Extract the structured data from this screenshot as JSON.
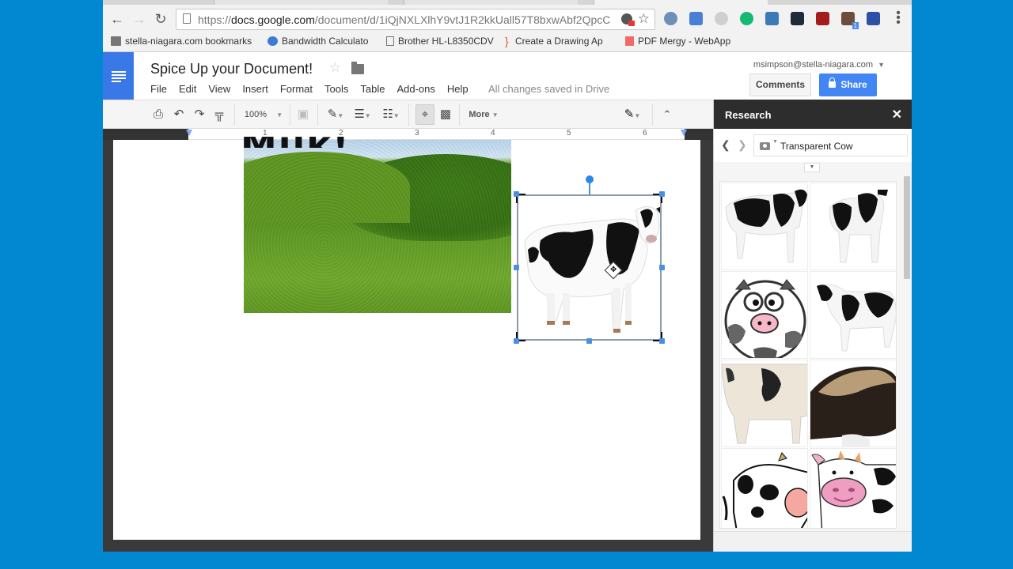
{
  "browser": {
    "url_prefix": "https://",
    "url_domain": "docs.google.com",
    "url_path": "/document/d/1iQjNXLXlhY9vtJ1R2kkUall57T8bxwAbf2QpcC",
    "extensions": [
      {
        "name": "pinterest-extension",
        "color": "#6e8fb8"
      },
      {
        "name": "b-extension",
        "color": "#4a7fd4"
      },
      {
        "name": "copyright-extension",
        "color": "#cfcfcf"
      },
      {
        "name": "grammarly-extension",
        "color": "#15b96f"
      },
      {
        "name": "screencastify-extension",
        "color": "#3b7ab8"
      },
      {
        "name": "camera-extension",
        "color": "#1f2b3a"
      },
      {
        "name": "film-extension",
        "color": "#a31d1d"
      },
      {
        "name": "s-extension",
        "color": "#6b4f3a",
        "badge": "1"
      },
      {
        "name": "n-extension",
        "color": "#2e4fa6"
      }
    ],
    "bookmarks": [
      {
        "label": "stella-niagara.com bookmarks",
        "icon": "folder-icon"
      },
      {
        "label": "Bandwidth Calculato",
        "icon": "bandwidth-icon"
      },
      {
        "label": "Brother HL-L8350CDV",
        "icon": "page-icon"
      },
      {
        "label": "Create a Drawing Ap",
        "icon": "drawing-icon"
      },
      {
        "label": "PDF Mergy - WebApp",
        "icon": "pdf-icon"
      }
    ]
  },
  "docs": {
    "title": "Spice Up your Document!",
    "menu": [
      "File",
      "Edit",
      "View",
      "Insert",
      "Format",
      "Tools",
      "Table",
      "Add-ons",
      "Help"
    ],
    "save_status": "All changes saved in Drive",
    "account": "msimpson@stella-niagara.com",
    "comments_label": "Comments",
    "share_label": "Share",
    "toolbar": {
      "zoom": "100%",
      "more_label": "More"
    },
    "ruler_numbers": [
      "1",
      "2",
      "3",
      "4",
      "5",
      "6"
    ],
    "heading_fragment": "Milk!"
  },
  "research": {
    "title": "Research",
    "query": "Transparent Cow",
    "results": [
      {
        "name": "cow-photo-1",
        "kind": "photo"
      },
      {
        "name": "cow-photo-2",
        "kind": "photo"
      },
      {
        "name": "cartoon-cow-round",
        "kind": "cartoon"
      },
      {
        "name": "cow-photo-3",
        "kind": "photo"
      },
      {
        "name": "cow-photo-4",
        "kind": "photo"
      },
      {
        "name": "cow-photo-hairy",
        "kind": "photo"
      },
      {
        "name": "cartoon-cow-side",
        "kind": "cartoon"
      },
      {
        "name": "cartoon-cow-pink-nose",
        "kind": "cartoon"
      }
    ]
  }
}
